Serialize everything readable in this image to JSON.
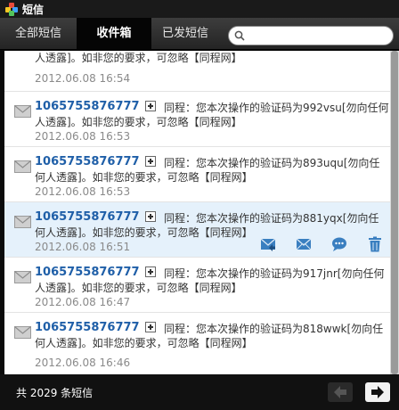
{
  "window": {
    "title": "短信"
  },
  "tabs": {
    "all": "全部短信",
    "inbox": "收件箱",
    "sent": "已发短信"
  },
  "search": {
    "value": "",
    "placeholder": ""
  },
  "messages": [
    {
      "sender": "",
      "body": "人透露]。如非您的要求，可忽略【同程网】",
      "time": "2012.06.08 16:54"
    },
    {
      "sender": "1065755876777",
      "body": "同程：您本次操作的验证码为992vsu[勿向任何人透露]。如非您的要求，可忽略【同程网】",
      "time": "2012.06.08 16:53"
    },
    {
      "sender": "1065755876777",
      "body": "同程：您本次操作的验证码为893uqu[勿向任何人透露]。如非您的要求，可忽略【同程网】",
      "time": "2012.06.08 16:53"
    },
    {
      "sender": "1065755876777",
      "body": "同程：您本次操作的验证码为881yqx[勿向任何人透露]。如非您的要求，可忽略【同程网】",
      "time": "2012.06.08 16:51"
    },
    {
      "sender": "1065755876777",
      "body": "同程：您本次操作的验证码为917jnr[勿向任何人透露]。如非您的要求，可忽略【同程网】",
      "time": "2012.06.08 16:47"
    },
    {
      "sender": "1065755876777",
      "body": "同程：您本次操作的验证码为818wwk[勿向任何人透露]。如非您的要求，可忽略【同程网】",
      "time": "2012.06.08 16:46"
    }
  ],
  "footer": {
    "count": "共 2029 条短信"
  },
  "colors": {
    "sender": "#1f5fa8",
    "highlight_row": "#e5f1fb",
    "action_icon": "#3a7fc0"
  },
  "icons": {
    "row": "envelope-icon",
    "expand": "plus-icon",
    "actions": [
      "reply-icon",
      "forward-icon",
      "chat-icon",
      "trash-icon"
    ],
    "nav": [
      "arrow-left-icon",
      "arrow-right-icon"
    ]
  }
}
